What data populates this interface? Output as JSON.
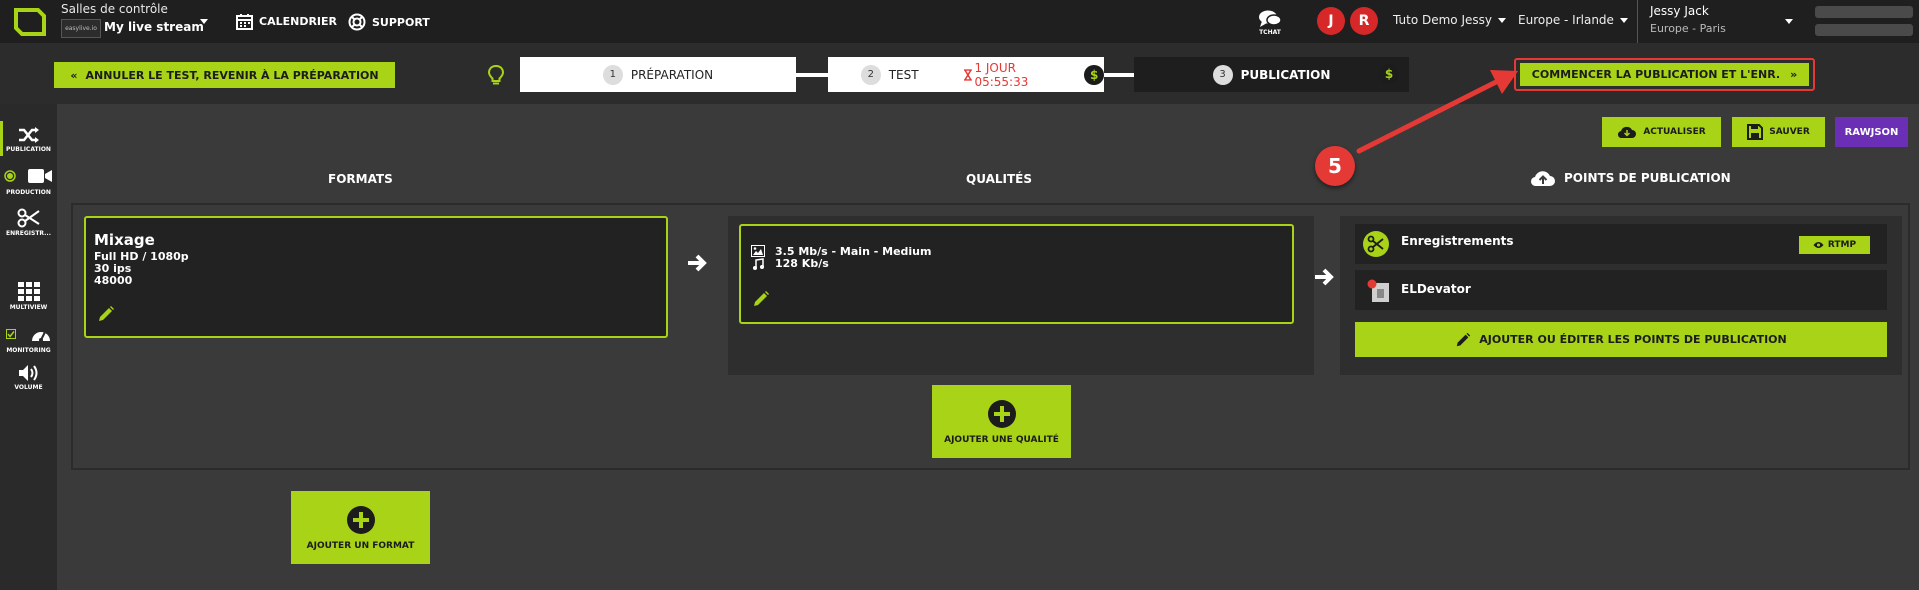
{
  "colors": {
    "accent": "#a8d317",
    "danger": "#e53935",
    "purple": "#6a2fb5",
    "dark": "#1f1f1f"
  },
  "topbar": {
    "control_rooms_label": "Salles de contrôle",
    "stream_thumb_text": "easylive.io",
    "stream_name": "My live stream",
    "calendar_label": "CALENDRIER",
    "support_label": "SUPPORT",
    "tchat_label": "TCHAT",
    "avatars": [
      "J",
      "R"
    ],
    "workspace": "Tuto Demo Jessy",
    "region": "Europe - Irlande",
    "user_name": "Jessy Jack",
    "user_timezone": "Europe - Paris"
  },
  "steps": {
    "cancel_label": "ANNULER LE TEST, REVENIR À LA PRÉPARATION",
    "items": [
      {
        "num": "1",
        "label": "PRÉPARATION"
      },
      {
        "num": "2",
        "label": "TEST"
      },
      {
        "num": "3",
        "label": "PUBLICATION"
      }
    ],
    "timer": "1 JOUR 05:55:33",
    "dollar": "$",
    "start_label": "COMMENCER LA PUBLICATION ET L'ENR."
  },
  "sidebar": {
    "items": [
      "PUBLICATION",
      "PRODUCTION",
      "ENREGISTR...",
      "MULTIVIEW",
      "MONITORING",
      "VOLUME"
    ]
  },
  "toolbar": {
    "refresh_label": "ACTUALISER",
    "save_label": "SAUVER",
    "rawjson_label": "RAWJSON"
  },
  "columns": {
    "formats": "FORMATS",
    "qualities": "QUALITÉS",
    "destinations": "POINTS DE PUBLICATION"
  },
  "format": {
    "title": "Mixage",
    "resolution": "Full HD / 1080p",
    "fps": "30 ips",
    "samplerate": "48000"
  },
  "quality": {
    "video": "3.5 Mb/s  -  Main  -  Medium",
    "audio": "128 Kb/s"
  },
  "destinations": {
    "items": [
      {
        "name": "Enregistrements",
        "tag": "RTMP"
      },
      {
        "name": "ELDevator"
      }
    ],
    "add_label": "AJOUTER OU ÉDITER LES POINTS DE PUBLICATION"
  },
  "add_quality_label": "AJOUTER UNE QUALITÉ",
  "add_format_label": "AJOUTER UN FORMAT",
  "annotation": {
    "step_number": "5"
  }
}
